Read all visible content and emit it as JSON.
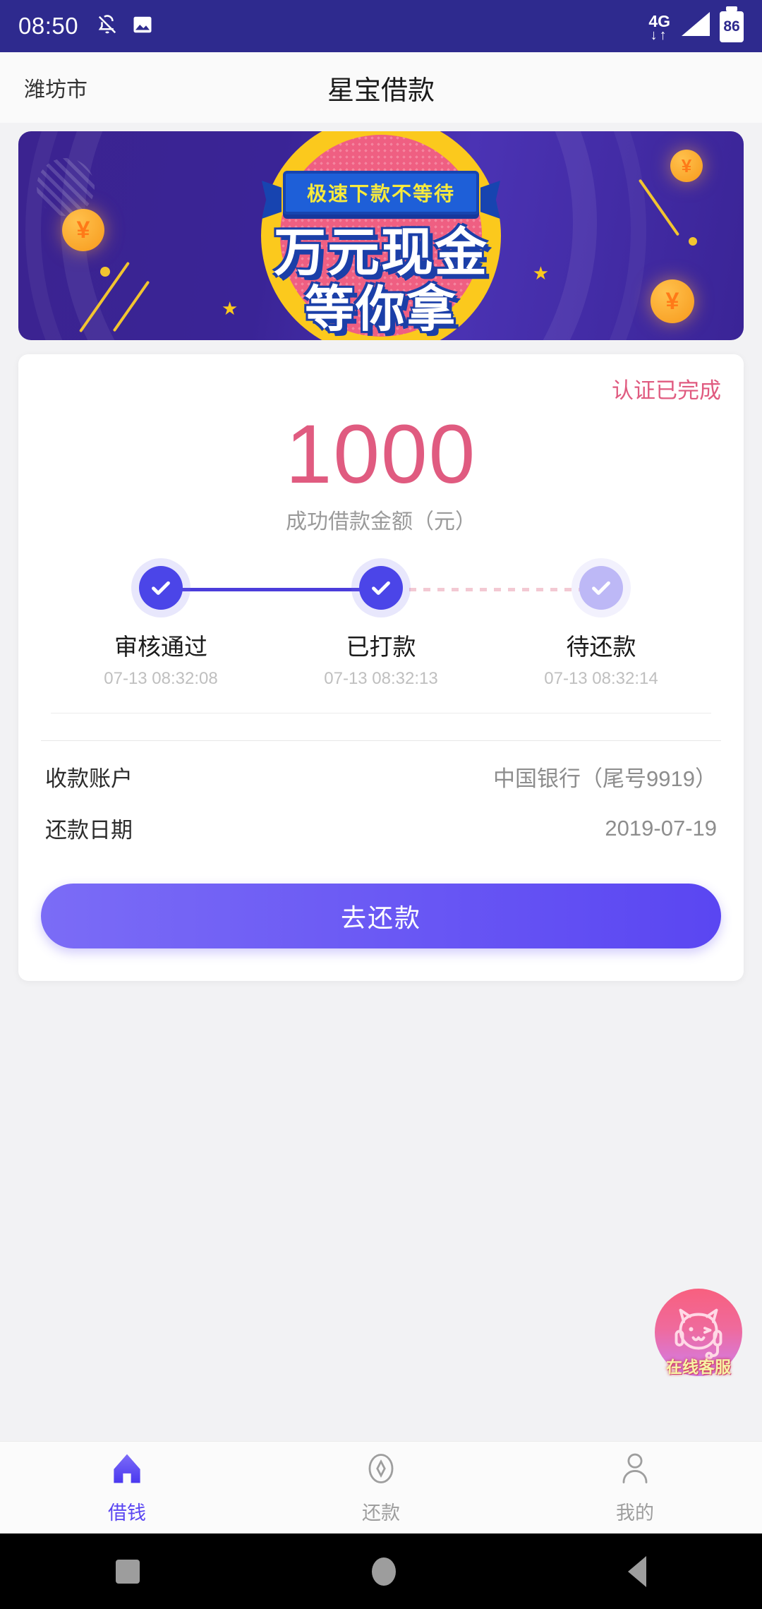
{
  "status_bar": {
    "time": "08:50",
    "icons": [
      "bell-off-icon",
      "image-icon"
    ],
    "network_label": "4G",
    "network_arrows": "↓↑",
    "battery_percent": "86"
  },
  "header": {
    "city": "潍坊市",
    "title": "星宝借款"
  },
  "banner": {
    "ribbon_text": "极速下款不等待",
    "line1": "万元现金",
    "line2": "等你拿",
    "coin_symbol": "¥",
    "star_glyph": "★",
    "colors": {
      "background": "#3b2390",
      "outer_circle": "#fbc91d",
      "inner_circle": "#ef5f82",
      "ribbon": "#1e5fd8",
      "ribbon_text": "#f7ea3d"
    }
  },
  "loan_card": {
    "cert_status": "认证已完成",
    "cert_color": "#e05b80",
    "amount": "1000",
    "amount_label": "成功借款金额（元）",
    "steps": [
      {
        "name": "审核通过",
        "time": "07-13 08:32:08",
        "state": "done"
      },
      {
        "name": "已打款",
        "time": "07-13 08:32:13",
        "state": "done"
      },
      {
        "name": "待还款",
        "time": "07-13 08:32:14",
        "state": "pending"
      }
    ],
    "info_rows": [
      {
        "key": "收款账户",
        "value": "中国银行（尾号9919）"
      },
      {
        "key": "还款日期",
        "value": "2019-07-19"
      }
    ],
    "cta_label": "去还款"
  },
  "service_widget": {
    "label": "在线客服",
    "icon": "cat-headset-icon"
  },
  "tab_bar": {
    "items": [
      {
        "label": "借钱",
        "icon": "home-icon",
        "active": true
      },
      {
        "label": "还款",
        "icon": "diamond-icon",
        "active": false
      },
      {
        "label": "我的",
        "icon": "person-icon",
        "active": false
      }
    ]
  },
  "system_nav": {
    "recent": "square-icon",
    "home": "circle-icon",
    "back": "triangle-back-icon"
  }
}
